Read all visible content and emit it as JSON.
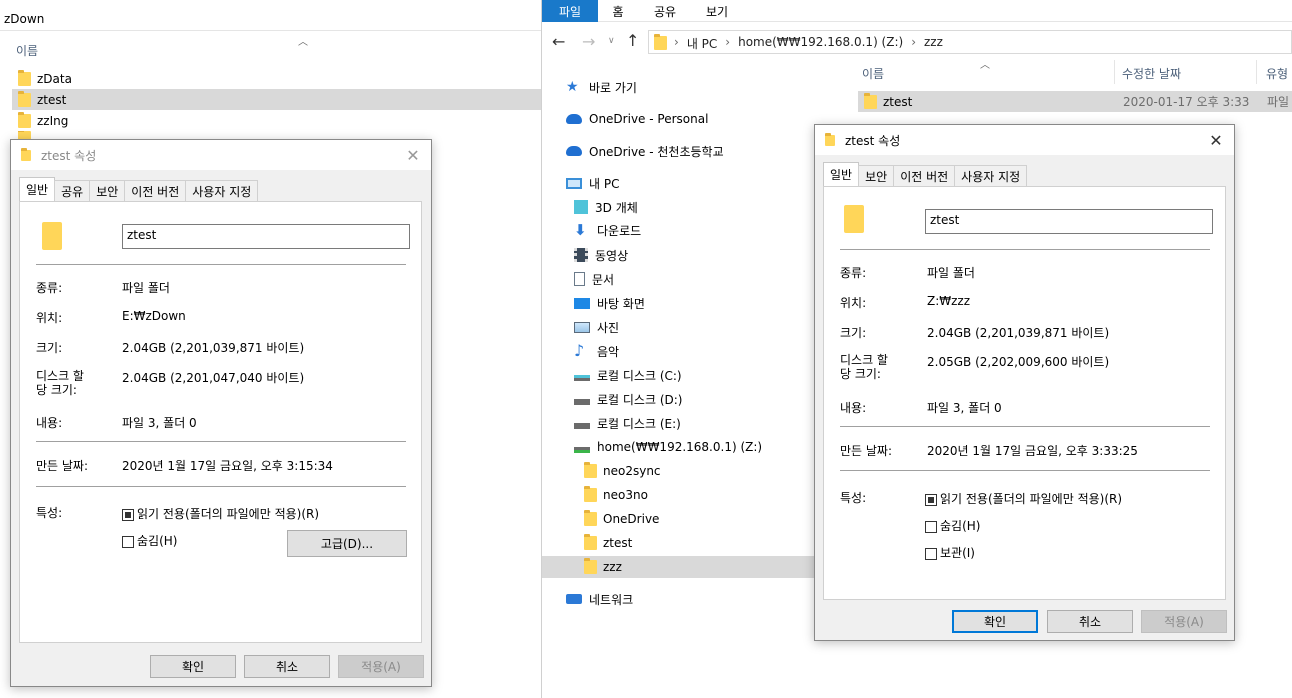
{
  "left_window": {
    "title": "zDown",
    "column_name": "이름",
    "items": [
      "zData",
      "ztest",
      "zzIng",
      "z..."
    ]
  },
  "left_dialog": {
    "title": "ztest 속성",
    "tabs": [
      "일반",
      "공유",
      "보안",
      "이전 버전",
      "사용자 지정"
    ],
    "name": "ztest",
    "type_label": "종류:",
    "type_value": "파일 폴더",
    "location_label": "위치:",
    "location_value": "E:₩zDown",
    "size_label": "크기:",
    "size_value": "2.04GB (2,201,039,871 바이트)",
    "disk_label": "디스크 할\n당 크기:",
    "disk_value": "2.04GB (2,201,047,040 바이트)",
    "contents_label": "내용:",
    "contents_value": "파일 3, 폴더 0",
    "created_label": "만든 날짜:",
    "created_value": "2020년 1월 17일 금요일, 오후 3:15:34",
    "attr_label": "특성:",
    "readonly": "읽기 전용(폴더의 파일에만 적용)(R)",
    "hidden": "숨김(H)",
    "advanced": "고급(D)...",
    "ok": "확인",
    "cancel": "취소",
    "apply": "적용(A)"
  },
  "right_window": {
    "ribbon_tabs": [
      "파일",
      "홈",
      "공유",
      "보기"
    ],
    "breadcrumb": [
      "내 PC",
      "home(₩₩192.168.0.1) (Z:)",
      "zzz"
    ],
    "nav": [
      {
        "label": "바로 가기",
        "icon": "star-icon"
      },
      {
        "label": "OneDrive - Personal",
        "icon": "cloud-icon"
      },
      {
        "label": "OneDrive - 천천초등학교",
        "icon": "cloud-icon"
      },
      {
        "label": "내 PC",
        "icon": "pc-icon"
      },
      {
        "label": "3D 개체",
        "icon": "cube-icon"
      },
      {
        "label": "다운로드",
        "icon": "download-icon"
      },
      {
        "label": "동영상",
        "icon": "video-icon"
      },
      {
        "label": "문서",
        "icon": "document-icon"
      },
      {
        "label": "바탕 화면",
        "icon": "desktop-icon"
      },
      {
        "label": "사진",
        "icon": "picture-icon"
      },
      {
        "label": "음악",
        "icon": "music-icon"
      },
      {
        "label": "로컬 디스크 (C:)",
        "icon": "drive-icon"
      },
      {
        "label": "로컬 디스크 (D:)",
        "icon": "drive-icon"
      },
      {
        "label": "로컬 디스크 (E:)",
        "icon": "drive-icon"
      },
      {
        "label": "home(₩₩192.168.0.1) (Z:)",
        "icon": "network-drive-icon"
      },
      {
        "label": "neo2sync",
        "icon": "folder-icon"
      },
      {
        "label": "neo3no",
        "icon": "folder-icon"
      },
      {
        "label": "OneDrive",
        "icon": "folder-icon"
      },
      {
        "label": "ztest",
        "icon": "folder-icon"
      },
      {
        "label": "zzz",
        "icon": "folder-icon"
      },
      {
        "label": "네트워크",
        "icon": "network-icon"
      }
    ],
    "columns": [
      "이름",
      "수정한 날짜",
      "유형"
    ],
    "file_row": {
      "name": "ztest",
      "date": "2020-01-17 오후 3:33",
      "type": "파일"
    }
  },
  "right_dialog": {
    "title": "ztest 속성",
    "tabs": [
      "일반",
      "보안",
      "이전 버전",
      "사용자 지정"
    ],
    "name": "ztest",
    "type_label": "종류:",
    "type_value": "파일 폴더",
    "location_label": "위치:",
    "location_value": "Z:₩zzz",
    "size_label": "크기:",
    "size_value": "2.04GB (2,201,039,871 바이트)",
    "disk_label": "디스크 할\n당 크기:",
    "disk_value": "2.05GB (2,202,009,600 바이트)",
    "contents_label": "내용:",
    "contents_value": "파일 3, 폴더 0",
    "created_label": "만든 날짜:",
    "created_value": "2020년 1월 17일 금요일, 오후 3:33:25",
    "attr_label": "특성:",
    "readonly": "읽기 전용(폴더의 파일에만 적용)(R)",
    "hidden": "숨김(H)",
    "archive": "보관(I)",
    "ok": "확인",
    "cancel": "취소",
    "apply": "적용(A)"
  }
}
